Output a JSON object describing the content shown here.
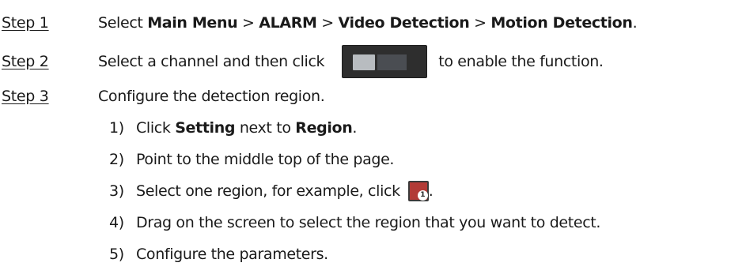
{
  "steps": [
    {
      "label": "Step 1",
      "prefix": "Select ",
      "menu1": "Main Menu",
      "sep1": " > ",
      "menu2": "ALARM",
      "sep2": " > ",
      "menu3": "Video Detection",
      "sep3": " > ",
      "menu4": "Motion Detection",
      "suffix": "."
    },
    {
      "label": "Step 2",
      "before": "Select a channel and then click",
      "after": "to enable the function.",
      "icon": "toggle-switch-icon"
    },
    {
      "label": "Step 3",
      "text": "Configure the detection region."
    }
  ],
  "substeps": [
    {
      "num": "1)",
      "pre": "Click ",
      "bold1": "Setting",
      "mid": " next to ",
      "bold2": "Region",
      "post": "."
    },
    {
      "num": "2)",
      "text": "Point to the middle top of the page."
    },
    {
      "num": "3)",
      "text": "Select one region, for example, click",
      "icon": "region-1-icon",
      "post": "."
    },
    {
      "num": "4)",
      "text": "Drag on the screen to select the region that you want to detect."
    },
    {
      "num": "5)",
      "text": "Configure the parameters."
    }
  ],
  "colors": {
    "text": "#1a1a1a",
    "toggle_bg": "#2e2e2e",
    "toggle_knob": "#b8bcc0",
    "region_icon": "#b23a36"
  }
}
